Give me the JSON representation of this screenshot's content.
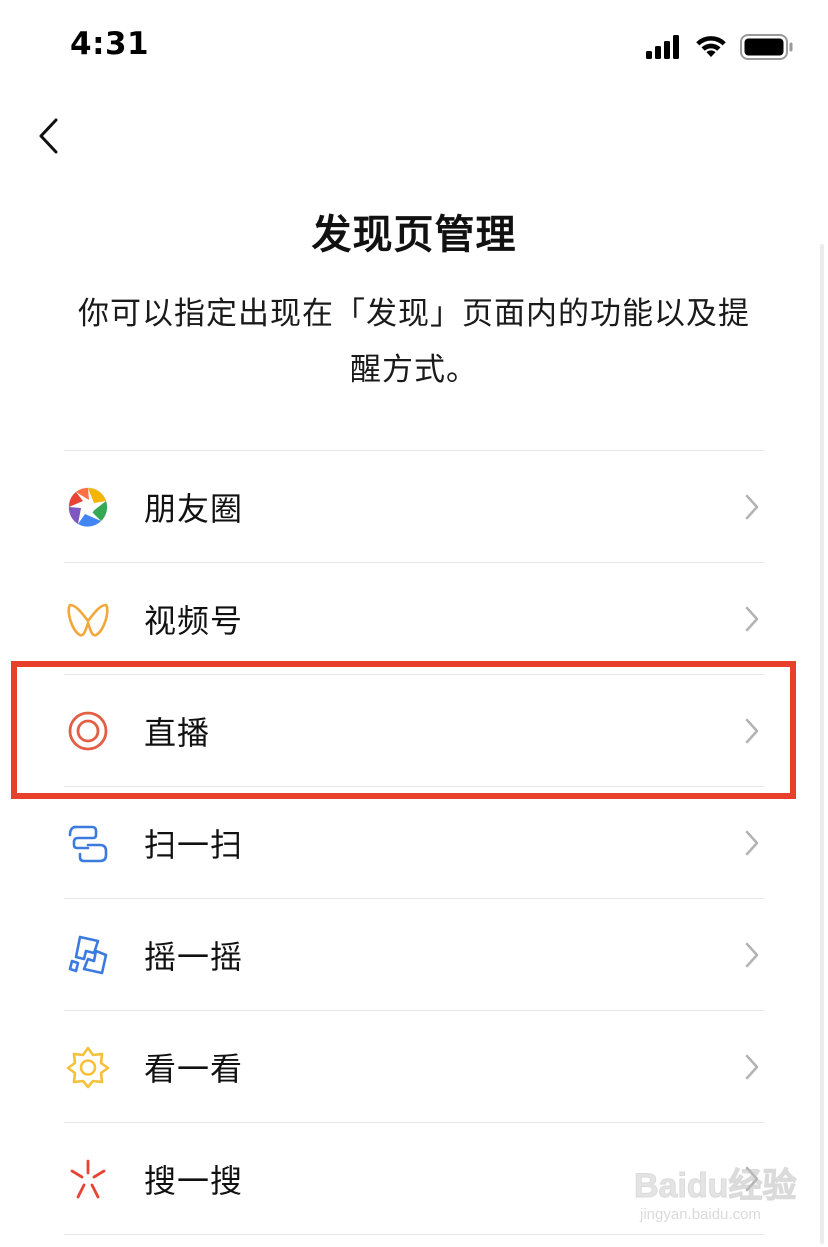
{
  "status_bar": {
    "time": "4:31",
    "icons": [
      "signal-icon",
      "wifi-icon",
      "battery-icon"
    ]
  },
  "navigation": {
    "back_icon": "chevron-left-icon"
  },
  "page": {
    "title": "发现页管理",
    "description": "你可以指定出现在「发现」页面内的功能以及提醒方式。"
  },
  "features": [
    {
      "label": "朋友圈",
      "icon": "moments-icon"
    },
    {
      "label": "视频号",
      "icon": "channels-icon"
    },
    {
      "label": "直播",
      "icon": "live-icon"
    },
    {
      "label": "扫一扫",
      "icon": "scan-icon"
    },
    {
      "label": "摇一摇",
      "icon": "shake-icon"
    },
    {
      "label": "看一看",
      "icon": "top-stories-icon"
    },
    {
      "label": "搜一搜",
      "icon": "search-icon"
    }
  ],
  "highlight": {
    "target": "直播",
    "color": "#e8402a"
  },
  "colors": {
    "moments": [
      "#f4b400",
      "#e94335",
      "#4285f4",
      "#34a853"
    ],
    "channels": "#f3a73a",
    "live": "#e25f45",
    "scan": "#3b7be0",
    "shake": "#3b7be0",
    "top_stories": "#f5c13b",
    "search": "#e94335"
  },
  "watermark": {
    "brand": "Baidu经验",
    "url": "jingyan.baidu.com"
  }
}
